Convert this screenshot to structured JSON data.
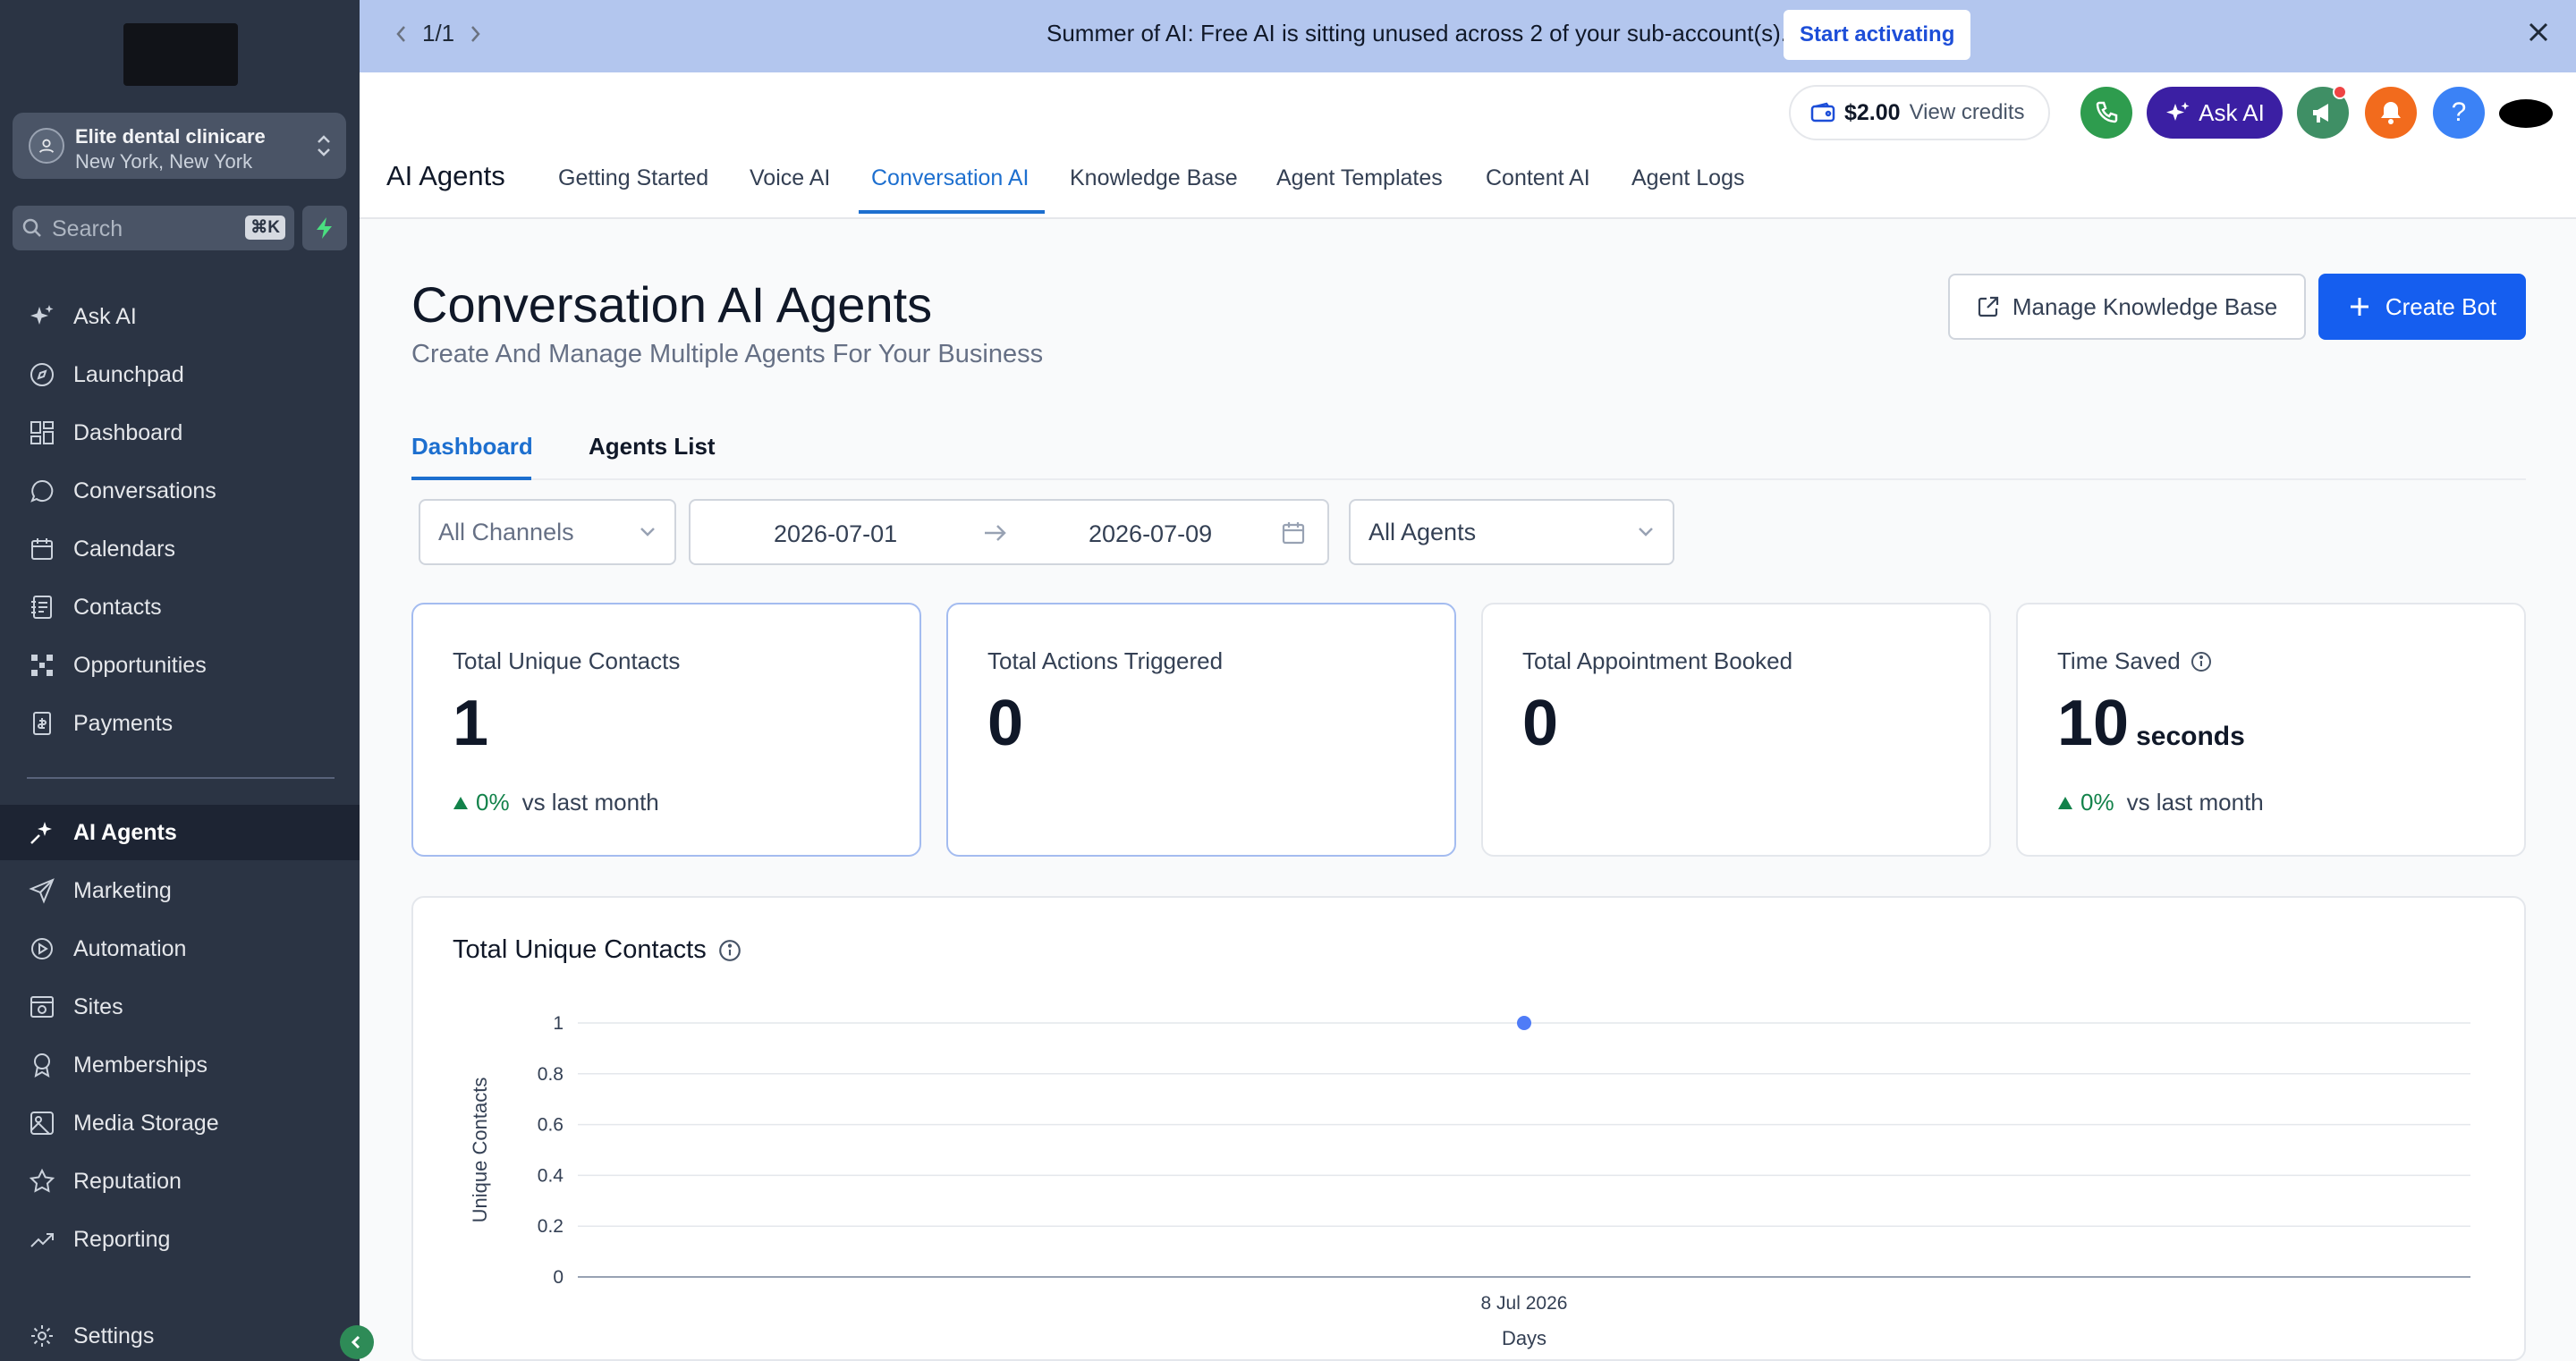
{
  "sidebar": {
    "account": {
      "name": "Elite dental clinicare",
      "location": "New York, New York"
    },
    "search": {
      "placeholder": "Search",
      "shortcut": "⌘K"
    },
    "items": [
      {
        "label": "Ask AI",
        "icon": "sparkle-icon"
      },
      {
        "label": "Launchpad",
        "icon": "rocket-icon"
      },
      {
        "label": "Dashboard",
        "icon": "grid-icon"
      },
      {
        "label": "Conversations",
        "icon": "chat-icon"
      },
      {
        "label": "Calendars",
        "icon": "calendar-icon"
      },
      {
        "label": "Contacts",
        "icon": "contacts-icon"
      },
      {
        "label": "Opportunities",
        "icon": "opportunities-icon"
      },
      {
        "label": "Payments",
        "icon": "payments-icon"
      },
      {
        "label": "AI Agents",
        "icon": "ai-agents-icon",
        "active": true
      },
      {
        "label": "Marketing",
        "icon": "send-icon"
      },
      {
        "label": "Automation",
        "icon": "automation-icon"
      },
      {
        "label": "Sites",
        "icon": "sites-icon"
      },
      {
        "label": "Memberships",
        "icon": "badge-icon"
      },
      {
        "label": "Media Storage",
        "icon": "image-icon"
      },
      {
        "label": "Reputation",
        "icon": "star-icon"
      },
      {
        "label": "Reporting",
        "icon": "trend-icon"
      }
    ],
    "settings": "Settings"
  },
  "banner": {
    "pager": "1/1",
    "message": "Summer of AI: Free AI is sitting unused across 2 of your sub-account(s).",
    "cta": "Start activating"
  },
  "header": {
    "credits_amount": "$2.00",
    "credits_label": "View credits",
    "ask_ai": "Ask AI",
    "help": "?",
    "page_title": "AI Agents",
    "tabs": [
      "Getting Started",
      "Voice AI",
      "Conversation AI",
      "Knowledge Base",
      "Agent Templates",
      "Content AI",
      "Agent Logs"
    ],
    "active_tab": "Conversation AI"
  },
  "main": {
    "title": "Conversation AI Agents",
    "subtitle": "Create And Manage Multiple Agents For Your Business",
    "manage_kb": "Manage Knowledge Base",
    "create_bot": "Create Bot",
    "subtabs": [
      "Dashboard",
      "Agents List"
    ],
    "filters": {
      "channels": "All Channels",
      "date_from": "2026-07-01",
      "date_to": "2026-07-09",
      "agents": "All Agents"
    },
    "cards": [
      {
        "label": "Total Unique Contacts",
        "value": "1",
        "trend": "0%",
        "trend_label": "vs last month"
      },
      {
        "label": "Total Actions Triggered",
        "value": "0"
      },
      {
        "label": "Total Appointment Booked",
        "value": "0"
      },
      {
        "label": "Time Saved",
        "value": "10",
        "unit": "seconds",
        "trend": "0%",
        "trend_label": "vs last month"
      }
    ]
  },
  "colors": {
    "accent": "#155eef",
    "sidebar": "#2b3444",
    "banner": "#b3c6ee",
    "positive": "#12824a"
  },
  "chart_data": {
    "type": "line",
    "title": "Total Unique Contacts",
    "xlabel": "Days",
    "ylabel": "Unique Contacts",
    "categories": [
      "8 Jul 2026"
    ],
    "series": [
      {
        "values": [
          1
        ]
      }
    ],
    "yticks": [
      "0",
      "0.2",
      "0.4",
      "0.6",
      "0.8",
      "1"
    ],
    "ylim": [
      0,
      1
    ],
    "grid": true
  }
}
